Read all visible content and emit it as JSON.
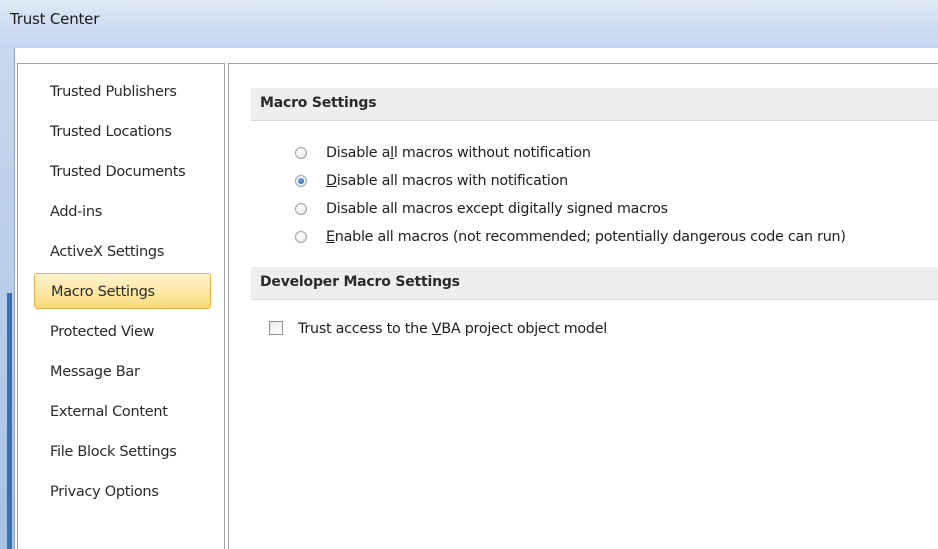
{
  "window": {
    "title": "Trust Center"
  },
  "sidebar": {
    "items": [
      {
        "label": "Trusted Publishers"
      },
      {
        "label": "Trusted Locations"
      },
      {
        "label": "Trusted Documents"
      },
      {
        "label": "Add-ins"
      },
      {
        "label": "ActiveX Settings"
      },
      {
        "label": "Macro Settings",
        "selected": true
      },
      {
        "label": "Protected View"
      },
      {
        "label": "Message Bar"
      },
      {
        "label": "External Content"
      },
      {
        "label": "File Block Settings"
      },
      {
        "label": "Privacy Options"
      }
    ]
  },
  "macro_settings": {
    "heading": "Macro Settings",
    "options": [
      {
        "label_pre": "Disable a",
        "label_key": "l",
        "label_post": "l macros without notification",
        "checked": false
      },
      {
        "label_pre": "",
        "label_key": "D",
        "label_post": "isable all macros with notification",
        "checked": true
      },
      {
        "label_pre": "Disable all macros except di",
        "label_key": "g",
        "label_post": "itally signed macros",
        "checked": false
      },
      {
        "label_pre": "",
        "label_key": "E",
        "label_post": "nable all macros (not recommended; potentially dangerous code can run)",
        "checked": false
      }
    ]
  },
  "developer_settings": {
    "heading": "Developer Macro Settings",
    "vba_access": {
      "label_pre": "Trust access to the ",
      "label_key": "V",
      "label_post": "BA project object model",
      "checked": false
    }
  }
}
